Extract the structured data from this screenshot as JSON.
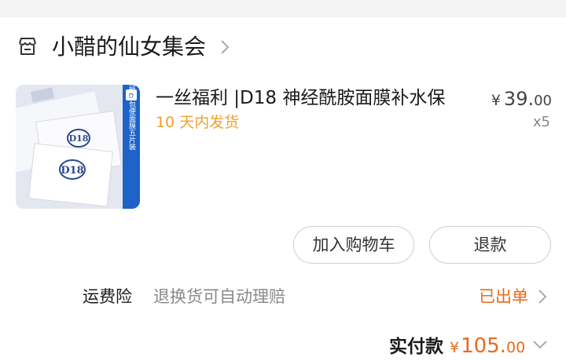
{
  "shop": {
    "name": "小醋的仙女集会",
    "icon": "store-icon"
  },
  "product": {
    "title": "一丝福利 |D18 神经酰胺面膜补水保",
    "shipping": "10 天内发货",
    "price": {
      "currency": "¥",
      "integer": "39.",
      "cents": "00"
    },
    "quantity": "x5",
    "image": {
      "brand": "D18",
      "side_text": "神经酰胺包便面膜五片装"
    }
  },
  "actions": {
    "add_to_cart": "加入购物车",
    "refund": "退款"
  },
  "insurance": {
    "label": "运费险",
    "description": "退换货可自动理赔",
    "status": "已出单"
  },
  "payment": {
    "label": "实付款",
    "currency": "¥",
    "integer": "105.",
    "cents": "00"
  },
  "colors": {
    "accent_orange": "#e86a1c",
    "shipping_orange": "#f0a030",
    "text_dark": "#1a1a1a",
    "text_muted": "#8a8a8a"
  }
}
